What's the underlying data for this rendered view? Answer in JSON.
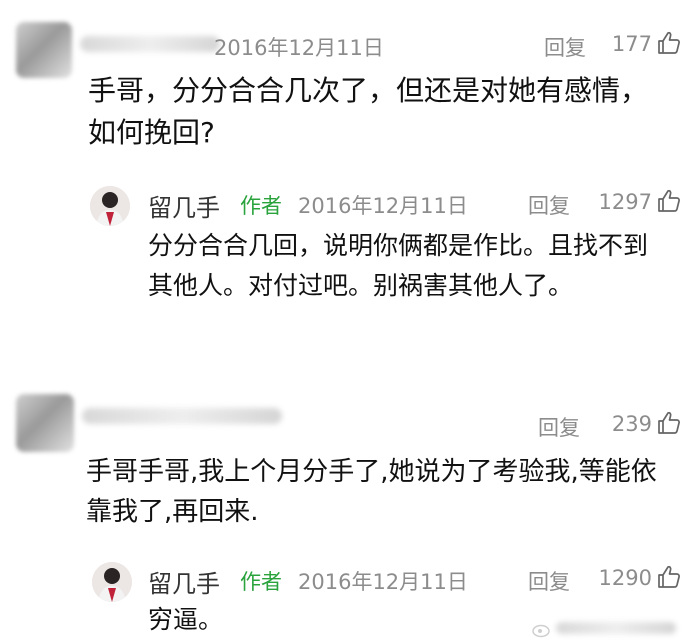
{
  "comments": [
    {
      "date": "2016年12月11日",
      "reply_label": "回复",
      "likes": "177",
      "text": "手哥，分分合合几次了，但还是对她有感情，如何挽回?",
      "reply": {
        "author_name": "留几手",
        "author_badge": "作者",
        "date": "2016年12月11日",
        "reply_label": "回复",
        "likes": "1297",
        "text": "分分合合几回，说明你俩都是作比。且找不到其他人。对付过吧。别祸害其他人了。"
      }
    },
    {
      "reply_label": "回复",
      "likes": "239",
      "text": "手哥手哥,我上个月分手了,她说为了考验我,等能依靠我了,再回来.",
      "reply": {
        "author_name": "留几手",
        "author_badge": "作者",
        "date": "2016年12月11日",
        "reply_label": "回复",
        "likes": "1290",
        "text": "穷逼。"
      }
    }
  ],
  "icons": {
    "like": "thumbs-up-icon"
  },
  "colors": {
    "author_badge": "#2aa33c",
    "meta": "#8c8c8c"
  }
}
